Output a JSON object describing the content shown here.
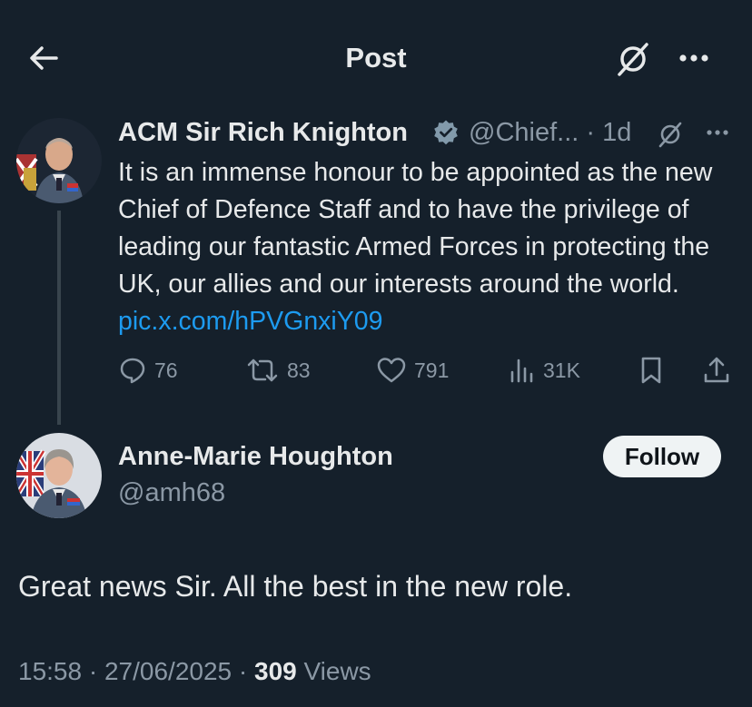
{
  "header": {
    "title": "Post"
  },
  "parent": {
    "author_name": "ACM Sir Rich Knighton",
    "handle": "@Chief...",
    "time": "1d",
    "text": "It is an immense honour to be appointed as the new Chief of Defence Staff and to have the privilege of leading our fantastic Armed Forces in protecting the UK, our allies and our interests around the world.",
    "link": "pic.x.com/hPVGnxiY09",
    "stats": {
      "replies": "76",
      "reposts": "83",
      "likes": "791",
      "views": "31K"
    }
  },
  "reply": {
    "author_name": "Anne-Marie Houghton",
    "handle": "@amh68",
    "follow_label": "Follow",
    "text": "Great news Sir. All the best in the new role.",
    "time": "15:58",
    "date": "27/06/2025",
    "views_count": "309",
    "views_label": "Views"
  },
  "colors": {
    "background": "#15202b",
    "link": "#1d9bf0",
    "muted": "#8b98a5",
    "verified": "#829aab"
  },
  "icons": [
    "back-arrow-icon",
    "grok-icon",
    "more-icon",
    "verified-badge-icon",
    "reply-icon",
    "repost-icon",
    "like-icon",
    "views-icon",
    "bookmark-icon",
    "share-icon"
  ]
}
